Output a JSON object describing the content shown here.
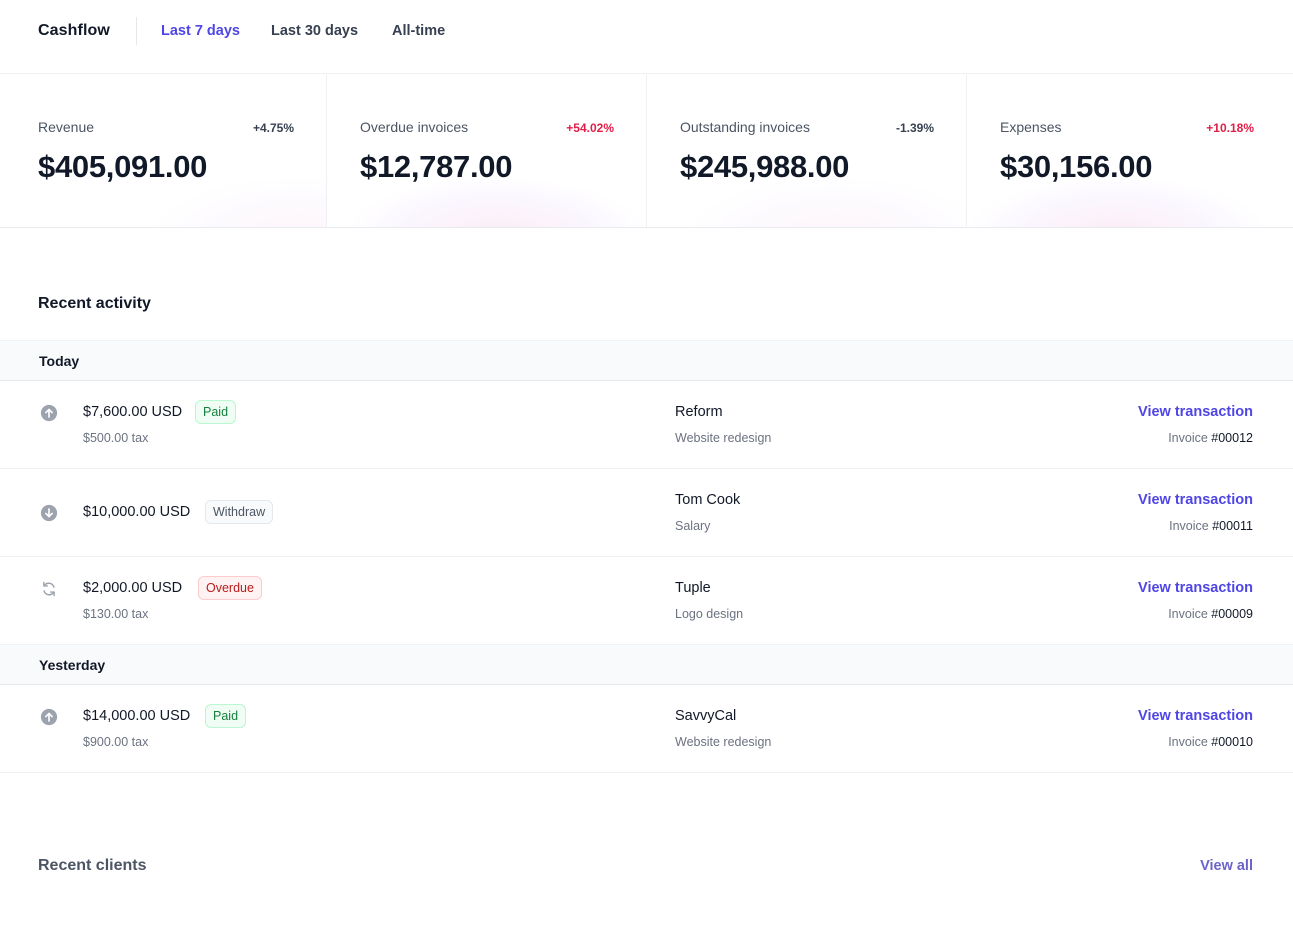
{
  "header": {
    "brand": "Cashflow",
    "tabs": [
      {
        "label": "Last 7 days",
        "active": true
      },
      {
        "label": "Last 30 days",
        "active": false
      },
      {
        "label": "All-time",
        "active": false
      }
    ]
  },
  "stats": [
    {
      "label": "Revenue",
      "change": "+4.75%",
      "change_color": "#374151",
      "value": "$405,091.00"
    },
    {
      "label": "Overdue invoices",
      "change": "+54.02%",
      "change_color": "#e11d48",
      "value": "$12,787.00"
    },
    {
      "label": "Outstanding invoices",
      "change": "-1.39%",
      "change_color": "#374151",
      "value": "$245,988.00"
    },
    {
      "label": "Expenses",
      "change": "+10.18%",
      "change_color": "#e11d48",
      "value": "$30,156.00"
    }
  ],
  "activity": {
    "title": "Recent activity",
    "groups": [
      {
        "label": "Today",
        "rows": [
          {
            "icon": "arrow-up-circle-icon",
            "amount": "$7,600.00 USD",
            "tax": "$500.00 tax",
            "status": "Paid",
            "client": "Reform",
            "description": "Website redesign",
            "link": "View transaction",
            "invoice_label": "Invoice",
            "invoice_number": "#00012"
          },
          {
            "icon": "arrow-down-circle-icon",
            "amount": "$10,000.00 USD",
            "tax": "",
            "status": "Withdraw",
            "client": "Tom Cook",
            "description": "Salary",
            "link": "View transaction",
            "invoice_label": "Invoice",
            "invoice_number": "#00011"
          },
          {
            "icon": "refresh-icon",
            "amount": "$2,000.00 USD",
            "tax": "$130.00 tax",
            "status": "Overdue",
            "client": "Tuple",
            "description": "Logo design",
            "link": "View transaction",
            "invoice_label": "Invoice",
            "invoice_number": "#00009"
          }
        ]
      },
      {
        "label": "Yesterday",
        "rows": [
          {
            "icon": "arrow-up-circle-icon",
            "amount": "$14,000.00 USD",
            "tax": "$900.00 tax",
            "status": "Paid",
            "client": "SavvyCal",
            "description": "Website redesign",
            "link": "View transaction",
            "invoice_label": "Invoice",
            "invoice_number": "#00010"
          }
        ]
      }
    ]
  },
  "clients": {
    "title": "Recent clients",
    "view_all": "View all"
  },
  "colors": {
    "accent": "#4f46e5",
    "negative": "#e11d48",
    "paid": "#15803d",
    "overdue": "#b91c1c"
  }
}
